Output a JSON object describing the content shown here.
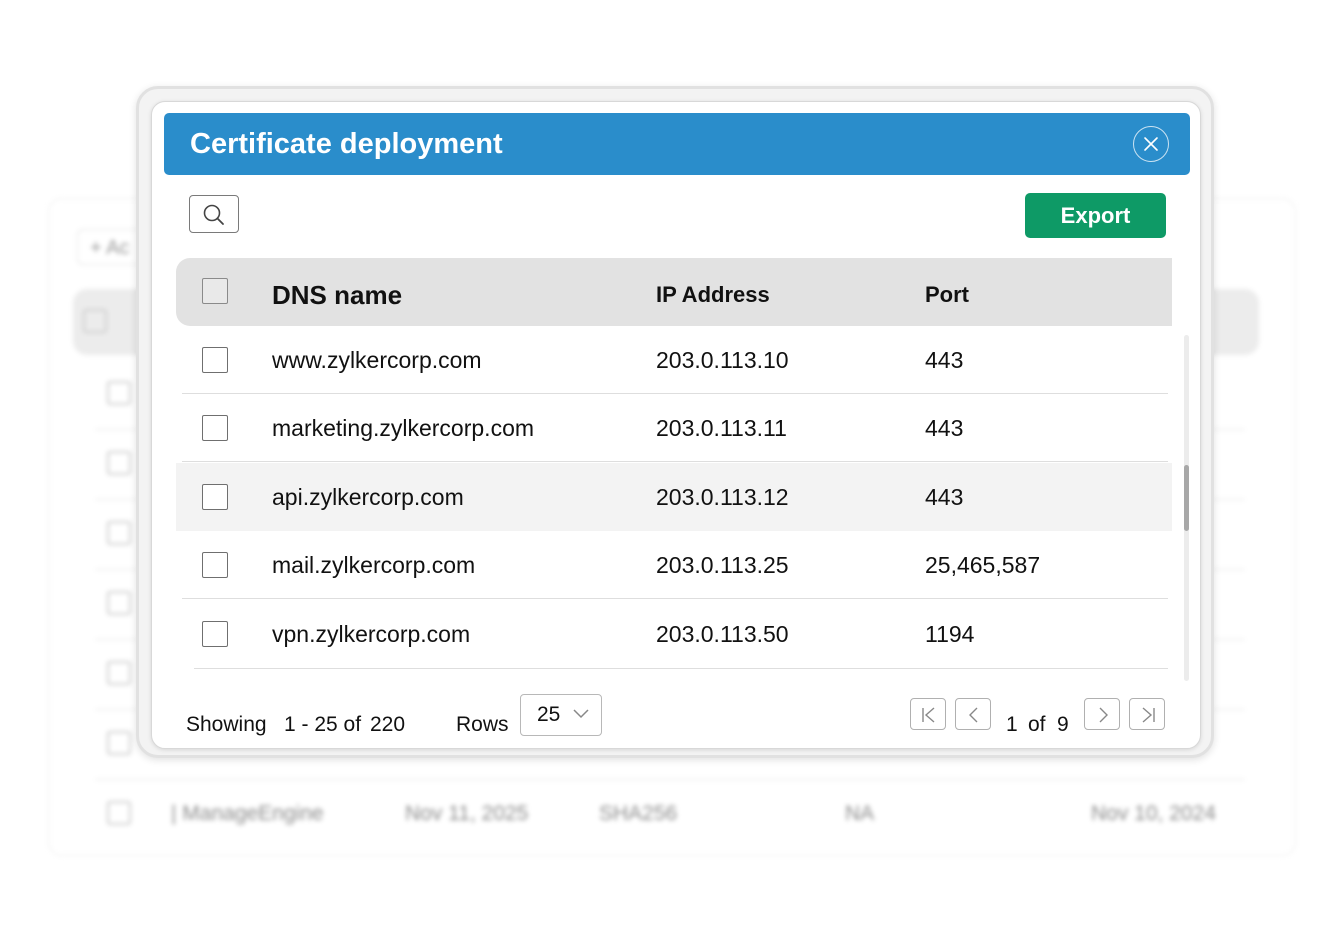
{
  "background": {
    "add_label": "+ Ac",
    "footer_row": {
      "name": "| ManageEngine",
      "expiry": "Nov 11, 2025",
      "algorithm": "SHA256",
      "status": "NA",
      "issued": "Nov 10, 2024"
    }
  },
  "modal": {
    "title": "Certificate deployment",
    "export_label": "Export",
    "table": {
      "headers": {
        "dns": "DNS name",
        "ip": "IP Address",
        "port": "Port"
      },
      "rows": [
        {
          "dns": "www.zylkercorp.com",
          "ip": "203.0.113.10",
          "port": "443"
        },
        {
          "dns": "marketing.zylkercorp.com",
          "ip": "203.0.113.11",
          "port": "443"
        },
        {
          "dns": "api.zylkercorp.com",
          "ip": "203.0.113.12",
          "port": "443"
        },
        {
          "dns": "mail.zylkercorp.com",
          "ip": "203.0.113.25",
          "port": "25,465,587"
        },
        {
          "dns": "vpn.zylkercorp.com",
          "ip": "203.0.113.50",
          "port": "1194"
        }
      ]
    },
    "footer": {
      "showing_label": "Showing",
      "range": "1 - 25 of",
      "total": "220",
      "rows_label": "Rows",
      "rows_value": "25",
      "page_current": "1",
      "page_of": "of",
      "page_total": "9"
    }
  },
  "colors": {
    "titlebar": "#2a8dcb",
    "export": "#0e9a66"
  }
}
